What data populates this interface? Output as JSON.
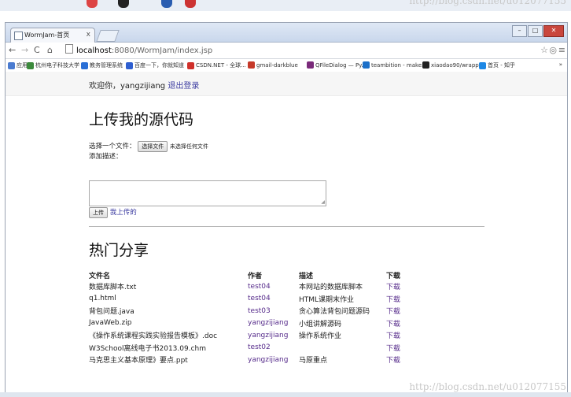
{
  "watermark": "http://blog.csdn.net/u012077155",
  "browser": {
    "tab_title": "WormJam-首页",
    "tab_close": "x",
    "url_host": "localhost",
    "url_path": ":8080/WormJam/index.jsp",
    "bookmarks": [
      {
        "label": "应用",
        "color": "#4a7bd0"
      },
      {
        "label": "杭州电子科技大学",
        "color": "#3c8a3c"
      },
      {
        "label": "教务管理系统",
        "color": "#2a6fd6"
      },
      {
        "label": "百度一下，你就知道",
        "color": "#2f5fd0"
      },
      {
        "label": "CSDN.NET - 全球...",
        "color": "#d0302a"
      },
      {
        "label": "gmail-darkblue",
        "color": "#c53929"
      },
      {
        "label": "QFileDialog — Py...",
        "color": "#7a2a7a"
      },
      {
        "label": "teambition - make...",
        "color": "#1b6fc8"
      },
      {
        "label": "xiaodao90/wrapper",
        "color": "#222222"
      },
      {
        "label": "首页 - 知乎",
        "color": "#1e88e5"
      }
    ],
    "more_bookmarks": "»"
  },
  "page": {
    "welcome_text": "欢迎你，yangzijiang",
    "logout_link": "退出登录",
    "upload_title": "上传我的源代码",
    "choose_file_label": "选择一个文件：",
    "choose_file_button": "选择文件",
    "no_file_text": "未选择任何文件",
    "desc_label": "添加描述：",
    "upload_button": "上传",
    "my_uploads_link": "我上传的",
    "hot_title": "热门分享",
    "table": {
      "headers": [
        "文件名",
        "作者",
        "描述",
        "下载"
      ],
      "rows": [
        {
          "file": "数据库脚本.txt",
          "author": "test04",
          "desc": "本网站的数据库脚本",
          "download": "下载"
        },
        {
          "file": "q1.html",
          "author": "test04",
          "desc": "HTML课期末作业",
          "download": "下载"
        },
        {
          "file": "背包问题.java",
          "author": "test03",
          "desc": "贪心算法背包问题源码",
          "download": "下载"
        },
        {
          "file": "JavaWeb.zip",
          "author": "yangzijiang",
          "desc": "小组讲解源码",
          "download": "下载"
        },
        {
          "file": "《操作系统课程实践实验报告模板》.doc",
          "author": "yangzijiang",
          "desc": "操作系统作业",
          "download": "下载"
        },
        {
          "file": "W3School离线电子书2013.09.chm",
          "author": "test02",
          "desc": "",
          "download": "下载"
        },
        {
          "file": "马克思主义基本原理》要点.ppt",
          "author": "yangzijiang",
          "desc": "马原重点",
          "download": "下载"
        }
      ]
    }
  }
}
